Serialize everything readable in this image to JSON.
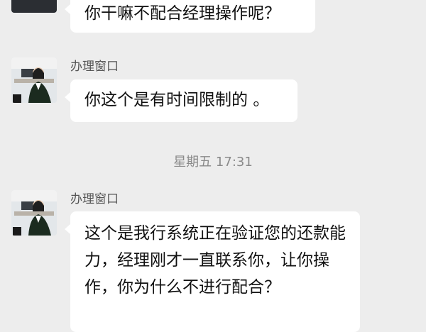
{
  "messages": [
    {
      "sender": "",
      "text": "你干嘛不配合经理操作呢？"
    },
    {
      "sender": "办理窗口",
      "text": "你这个是有时间限制的 。"
    },
    {
      "sender": "办理窗口",
      "text": "这个是我行系统正在验证您的还款能力，经理刚才一直联系你，让你操作，你为什么不进行配合？"
    }
  ],
  "timestamp": "星期五  17:31",
  "colors": {
    "background": "#ededed",
    "bubble": "#ffffff",
    "text": "#111111",
    "meta": "#8a8a8a"
  }
}
